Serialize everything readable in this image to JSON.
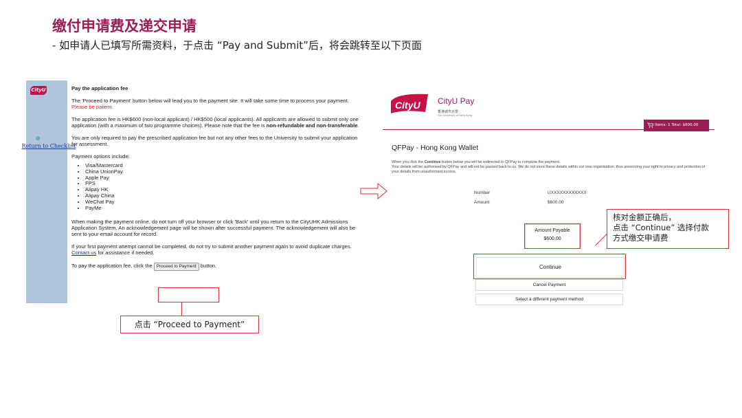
{
  "header": {
    "title": "缴付申请费及递交申请",
    "subtitle": "-   如申请人已填写所需资料，于点击 “Pay and Submit”后，将会跳转至以下页面"
  },
  "left_screen": {
    "logo_text": "CityU",
    "return_link": "Return to Checklist",
    "heading": "Pay the application fee",
    "para1": "The 'Proceed to Payment' button below will lead you to the payment site. It will take some time to process your payment. ",
    "para1_red": "Please be patient.",
    "para2": "The application fee is HK$600 (non-local applicant) / HK$500 (local applicants). All applicants are allowed to submit only one application (with a maximum of two programme choices). Please note that the fee is ",
    "para2_bold": "non-refundable and non-transferable",
    "para2_end": ".",
    "para3": "You are only required to pay the prescribed application fee but not any other fees to the University to submit your application for assessment.",
    "payment_options_label": "Payment options include:",
    "payment_options": [
      "Visa/Mastercard",
      "China UnionPay",
      "Apple Pay",
      "FPS",
      "Alipay HK",
      "Alipay China",
      "WeChat Pay",
      "PayMe"
    ],
    "para4": "When making the payment online, do not turn off your browser or click 'Back' until you return to the CityUHK Admissions Application System. An acknowledgement page will be shown after successful payment. The acknowledgement will also be sent to your email account for record.",
    "para5": "If your first payment attempt cannot be completed, do not try to submit another payment again to avoid duplicate charges. ",
    "contact_link": "Contact us",
    "para5_end": " for assistance if needed.",
    "para6_start": "To pay the application fee, click the ",
    "proceed_button": "Proceed to Payment",
    "para6_end": " button."
  },
  "annotations": {
    "proceed_callout": "点击 “Proceed to Payment”",
    "continue_callout_line1": "核对金额正确后，",
    "continue_callout_line2": "点击 “Continue” 选择付款",
    "continue_callout_line3": "方式缴交申请费"
  },
  "right_screen": {
    "logo_text": "CityU",
    "brand": "CityU Pay",
    "brand_cn": "香港城市大學",
    "brand_en": "City University of Hong Kong",
    "cart": "Items: 1 Total: $600.00",
    "page_title": "QFPay - Hong Kong Wallet",
    "desc1_start": "When you click the ",
    "desc1_bold": "Continue",
    "desc1_end": " button below you will be redirected to QFPay to complete the payment.",
    "desc2": "Your details will be authorised by QFPay and will not be passed back to us. We do not store these details within our own organisation, thus preserving your right to privacy and protection of your details from unauthorised access.",
    "number_label": "Number",
    "number_value": "UXXXXXXXXXXXX",
    "amount_label": "Amount",
    "amount_value": "$600.00",
    "amount_payable_label": "Amount Payable",
    "amount_payable_value": "$600.00",
    "continue_button": "Continue",
    "cancel_button": "Cancel Payment",
    "select_button": "Select a different payment method"
  },
  "colors": {
    "brand": "#9a1d56",
    "annotation": "#e03030",
    "sidebar": "#b0c4de"
  }
}
